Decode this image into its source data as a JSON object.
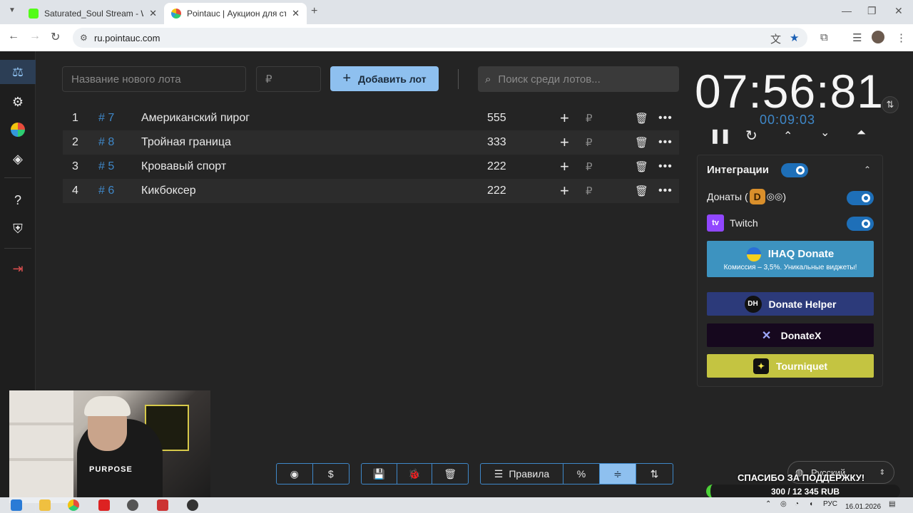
{
  "browser": {
    "tabs": [
      {
        "title": "Saturated_Soul Stream - Watch",
        "close": "✕"
      },
      {
        "title": "Pointauc | Аукцион для стриме",
        "close": "✕"
      }
    ],
    "new_tab": "+",
    "url": "ru.pointauc.com",
    "window_controls": {
      "minimize": "—",
      "maximize": "❐",
      "close": "✕"
    }
  },
  "form": {
    "lot_name_placeholder": "Название нового лота",
    "amount_placeholder": "₽",
    "add_button": "Добавить лот",
    "search_placeholder": "Поиск среди лотов..."
  },
  "lots": [
    {
      "num": "1",
      "id": "# 7",
      "name": "Американский пирог",
      "amount": "555",
      "currency": "₽"
    },
    {
      "num": "2",
      "id": "# 8",
      "name": "Тройная граница",
      "amount": "333",
      "currency": "₽"
    },
    {
      "num": "3",
      "id": "# 5",
      "name": "Кровавый спорт",
      "amount": "222",
      "currency": "₽"
    },
    {
      "num": "4",
      "id": "# 6",
      "name": "Кикбоксер",
      "amount": "222",
      "currency": "₽"
    }
  ],
  "timer": {
    "main": "07:56:81",
    "sub": "00:09:03"
  },
  "integrations": {
    "title": "Интеграции",
    "donations_label": "Донаты (",
    "donations_suffix": ")",
    "twitch_label": "Twitch",
    "services": [
      {
        "name": "IHAQ Donate",
        "subtitle": "Комиссия – 3,5%. Уникальные виджеты!",
        "color": "#3d93c0"
      },
      {
        "name": "Donate Helper",
        "color": "#2c3a7a"
      },
      {
        "name": "DonateX",
        "color": "#16081e"
      },
      {
        "name": "Tourniquet",
        "color": "#c4c441"
      }
    ]
  },
  "bottom_bar": {
    "rules_label": "Правила",
    "percent_label": "%",
    "dollar_label": "$"
  },
  "overlay": {
    "cam_shirt_text": "PURPOSE",
    "language": "Русский",
    "thanks": "СПАСИБО ЗА ПОДДЕРЖКУ!",
    "donation_goal": "300 / 12 345 RUB"
  },
  "taskbar": {
    "lang": "РУС",
    "date": "16.01.2026"
  },
  "colors": {
    "accent": "#8ec0ef",
    "link": "#3f88c9",
    "bg": "#242424"
  }
}
